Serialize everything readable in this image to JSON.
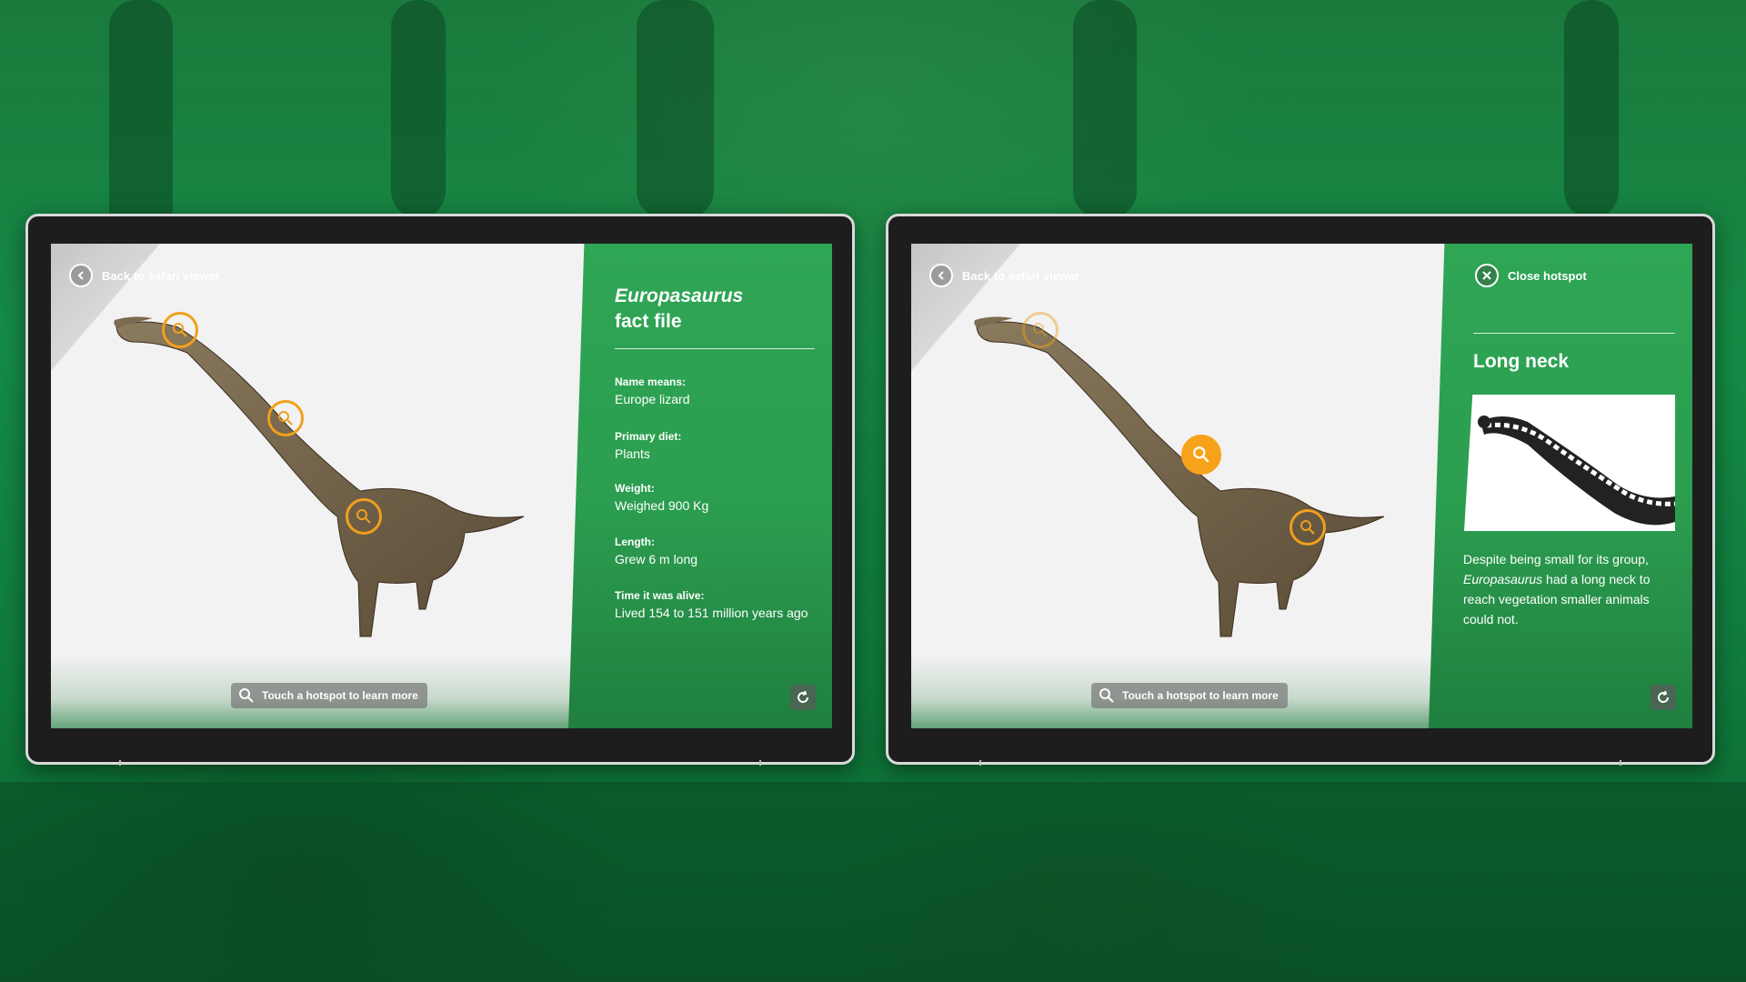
{
  "left_screen": {
    "back_label": "Back to safari viewer",
    "fact_title": {
      "species": "Europasaurus",
      "suffix": "fact file"
    },
    "facts": [
      {
        "label": "Name means:",
        "value": "Europe lizard"
      },
      {
        "label": "Primary diet:",
        "value": "Plants"
      },
      {
        "label": "Weight:",
        "value": "Weighed 900 Kg"
      },
      {
        "label": "Length:",
        "value": "Grew 6 m long"
      },
      {
        "label": "Time it was alive:",
        "value": "Lived 154 to 151 million years ago"
      }
    ],
    "touch_hint": "Touch a hotspot to learn more"
  },
  "right_screen": {
    "back_label": "Back to safari viewer",
    "close_label": "Close hotspot",
    "hotspot_title": "Long neck",
    "description": {
      "part1": "Despite being small for its group,",
      "italic": "Europasaurus",
      "part2": " had a long neck to reach vegetation smaller animals could not."
    },
    "touch_hint": "Touch a hotspot to learn more"
  },
  "colors": {
    "panel_green": "#2fa655",
    "hotspot_orange": "#f7a21b",
    "background_green": "#158a45"
  },
  "icons": [
    "chevron-left-icon",
    "close-icon",
    "search-icon",
    "refresh-icon"
  ]
}
